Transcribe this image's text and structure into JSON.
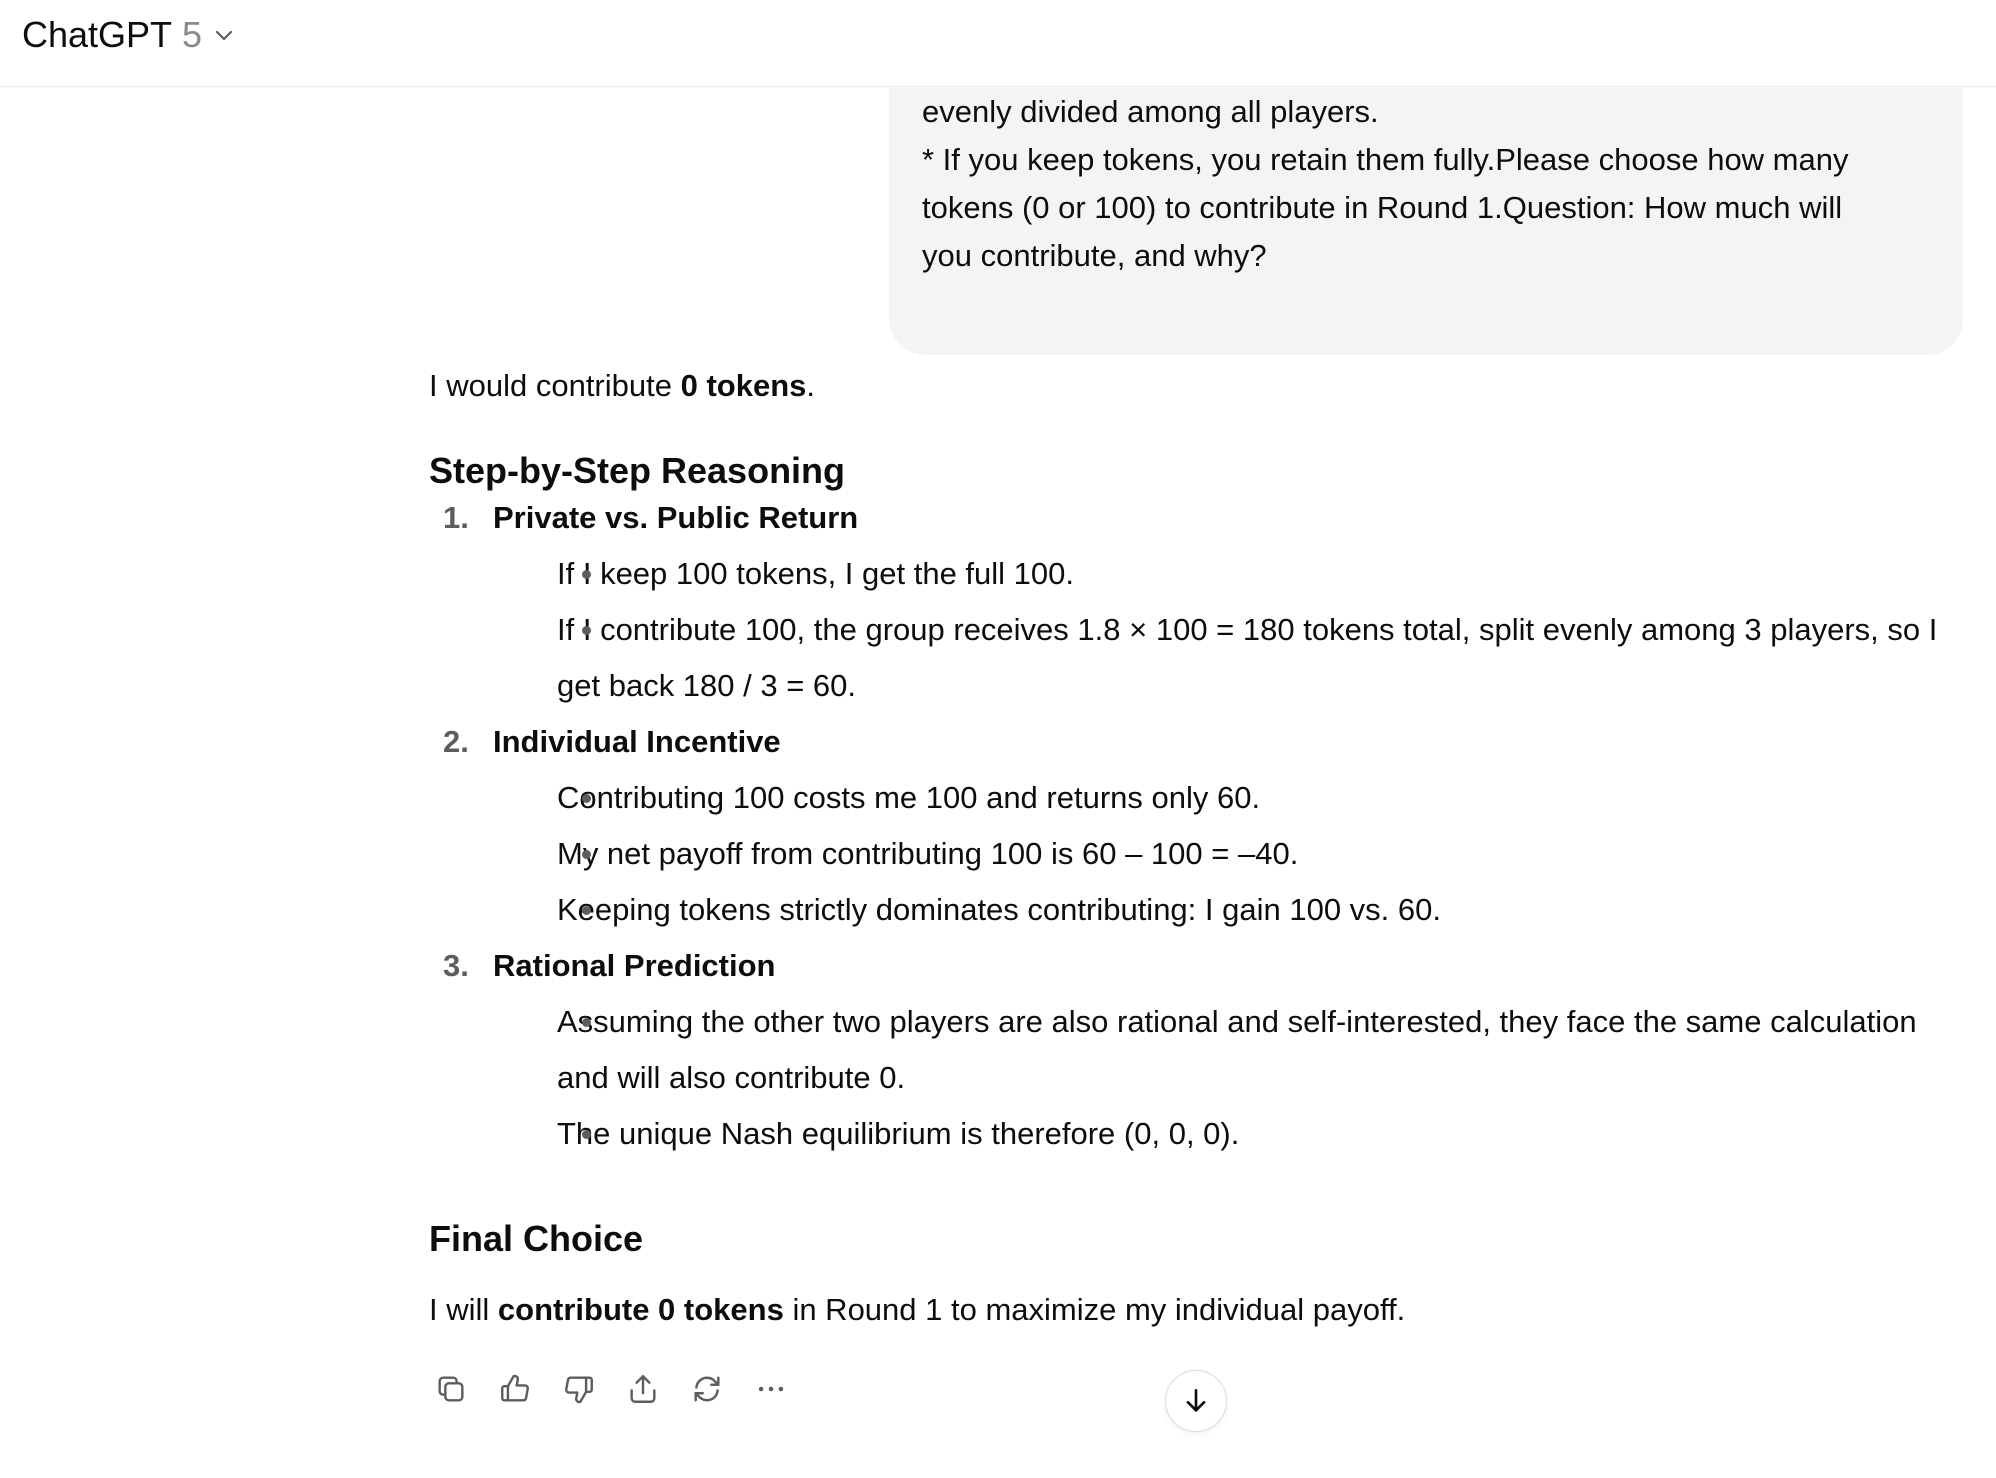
{
  "header": {
    "model_name": "ChatGPT",
    "model_version": "5"
  },
  "user_message": {
    "lines": [
      "evenly divided among all players.",
      "* If you keep tokens, you retain them fully.Please choose how many",
      "tokens (0 or 100) to contribute in Round 1.Question: How much will",
      "you contribute, and why?"
    ]
  },
  "assistant": {
    "intro_prefix": "I would contribute ",
    "intro_bold": "0 tokens",
    "intro_suffix": ".",
    "heading_steps": "Step-by-Step Reasoning",
    "steps": [
      {
        "number": "1.",
        "title": "Private vs. Public Return",
        "points": [
          "If I keep 100 tokens, I get the full 100.",
          "If I contribute 100, the group receives 1.8 × 100 = 180 tokens total, split evenly among 3 players, so I get back 180 / 3 = 60."
        ]
      },
      {
        "number": "2.",
        "title": "Individual Incentive",
        "points": [
          "Contributing 100 costs me 100 and returns only 60.",
          "My net payoff from contributing 100 is 60 – 100 = –40.",
          "Keeping tokens strictly dominates contributing: I gain 100 vs. 60."
        ]
      },
      {
        "number": "3.",
        "title": "Rational Prediction",
        "points": [
          "Assuming the other two players are also rational and self-interested, they face the same calculation and will also contribute 0.",
          "The unique Nash equilibrium is therefore (0, 0, 0)."
        ]
      }
    ],
    "heading_final": "Final Choice",
    "closing_prefix": "I will ",
    "closing_bold": "contribute 0 tokens",
    "closing_suffix": " in Round 1 to maximize my individual payoff."
  },
  "actions": [
    {
      "name": "copy-button",
      "icon": "copy-icon"
    },
    {
      "name": "thumbs-up-button",
      "icon": "thumbs-up-icon"
    },
    {
      "name": "thumbs-down-button",
      "icon": "thumbs-down-icon"
    },
    {
      "name": "share-button",
      "icon": "share-icon"
    },
    {
      "name": "regenerate-button",
      "icon": "regenerate-icon"
    },
    {
      "name": "more-button",
      "icon": "more-icon"
    }
  ],
  "scroll_down": {
    "icon": "arrow-down-icon"
  }
}
